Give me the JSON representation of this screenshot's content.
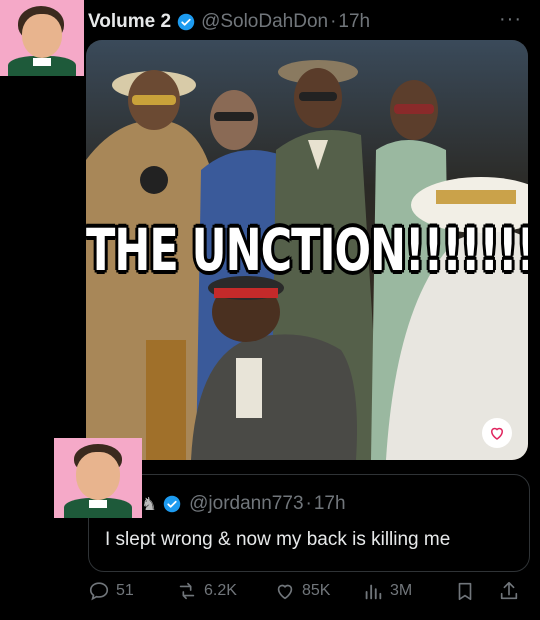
{
  "colors": {
    "background": "#000000",
    "text": "#e7e9ea",
    "muted": "#71767b",
    "verified": "#1d9bf0",
    "avatar_bg": "#f5a9c8"
  },
  "post": {
    "display_name": "Volume 2",
    "handle": "@SoloDahDon",
    "separator": "·",
    "time": "17h",
    "more_icon": "more-dots-icon"
  },
  "media": {
    "caption": "THE UNCTION!!!!!!!!",
    "like_icon": "heart-icon"
  },
  "quote": {
    "handle": "@jordann773",
    "separator": "·",
    "time": "17h",
    "text": "I slept wrong & now my back is killing me"
  },
  "actions": {
    "replies": "51",
    "reposts": "6.2K",
    "likes": "85K",
    "views": "3M"
  }
}
